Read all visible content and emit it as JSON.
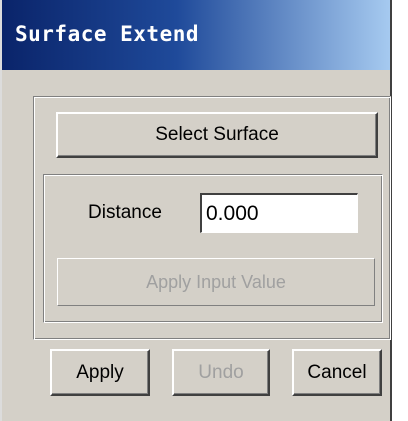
{
  "window": {
    "title": "Surface Extend"
  },
  "surface": {
    "select_label": "Select Surface"
  },
  "distance": {
    "label": "Distance",
    "value": "0.000",
    "apply_input_label": "Apply Input Value"
  },
  "actions": {
    "apply_label": "Apply",
    "undo_label": "Undo",
    "cancel_label": "Cancel"
  },
  "colors": {
    "titlebar_start": "#0a246a",
    "titlebar_end": "#a6caf0",
    "dialog_background": "#d4d0c8",
    "disabled_text": "#a0a0a0"
  }
}
